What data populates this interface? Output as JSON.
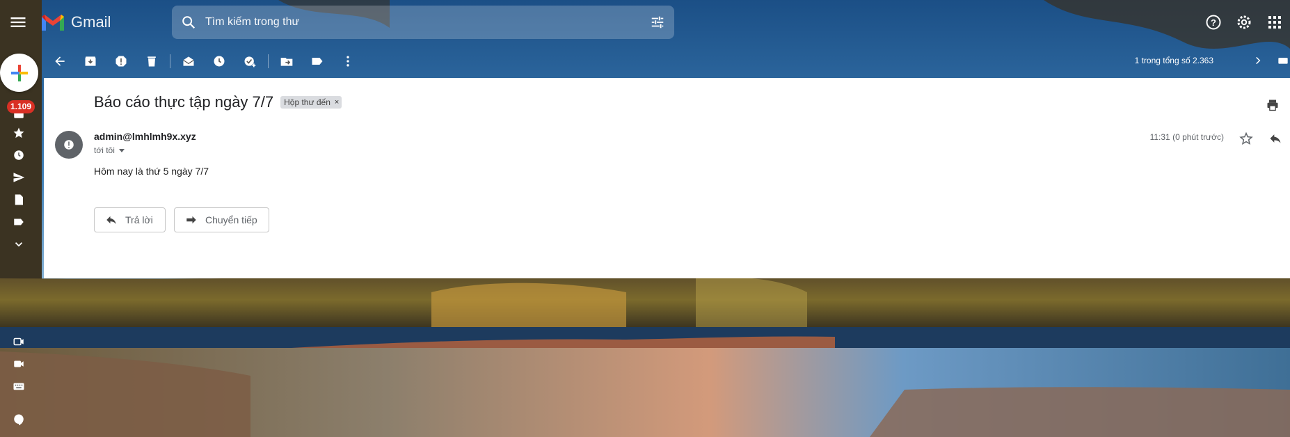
{
  "app": {
    "name": "Gmail",
    "accent_colors": [
      "#ea4335",
      "#4285f4",
      "#34a853",
      "#fbbc04"
    ]
  },
  "search": {
    "placeholder": "Tìm kiếm trong thư"
  },
  "toolbar": {
    "buttons": [
      "back-icon",
      "archive-icon",
      "report-spam-icon",
      "delete-icon",
      "mark-unread-icon",
      "snooze-icon",
      "add-task-icon",
      "move-to-icon",
      "label-icon",
      "more-vert-icon"
    ],
    "pagination": "1 trong tổng số 2.363"
  },
  "rail": {
    "inbox_badge": "1.109",
    "items": [
      "inbox-icon",
      "star-icon",
      "clock-icon",
      "send-icon",
      "draft-icon",
      "label-icon",
      "expand-more-icon"
    ],
    "bottom_items": [
      "meet-new-icon",
      "video-icon",
      "keyboard-icon",
      "hangouts-icon"
    ]
  },
  "message": {
    "subject": "Báo cáo thực tập ngày 7/7",
    "label": "Hộp thư đến",
    "label_remove": "×",
    "sender": "admin@lmhlmh9x.xyz",
    "to": "tới tôi",
    "time": "11:31 (0 phút trước)",
    "body": "Hôm nay là thứ 5 ngày 7/7"
  },
  "actions": {
    "reply": "Trả lời",
    "forward": "Chuyển tiếp"
  }
}
